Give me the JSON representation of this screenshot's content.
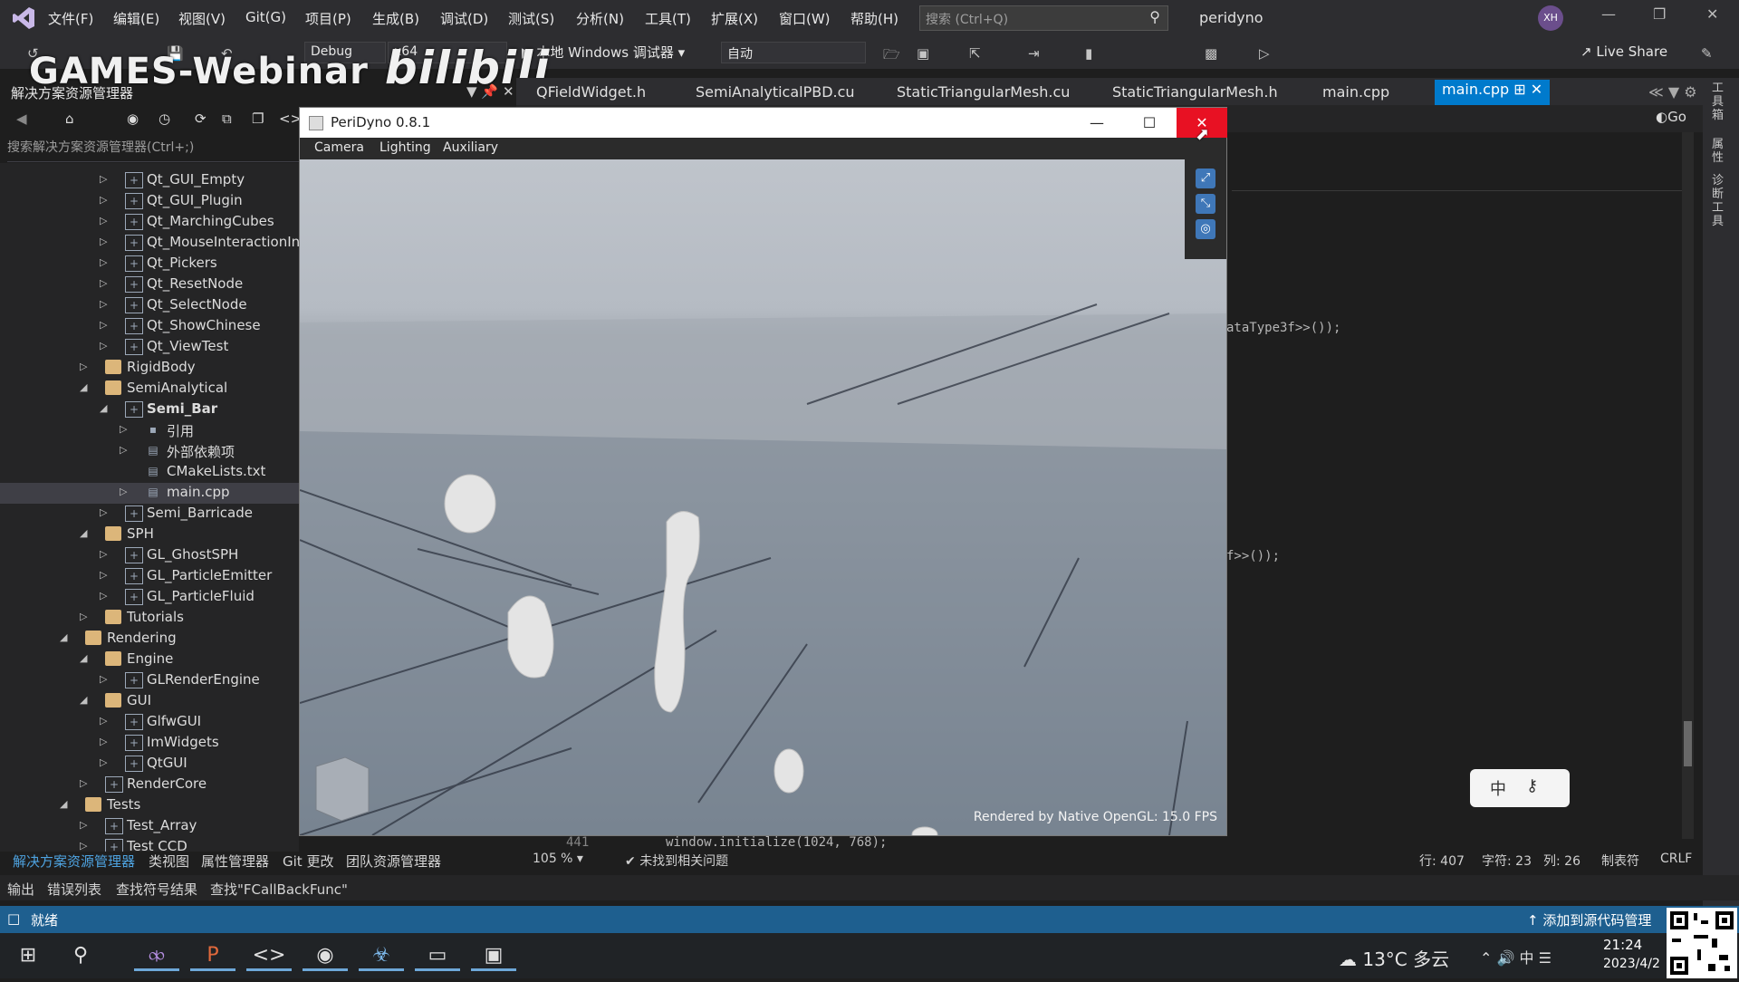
{
  "menubar": {
    "items": [
      "文件(F)",
      "编辑(E)",
      "视图(V)",
      "Git(G)",
      "项目(P)",
      "生成(B)",
      "调试(D)",
      "测试(S)",
      "分析(N)",
      "工具(T)",
      "扩展(X)",
      "窗口(W)",
      "帮助(H)"
    ],
    "search_placeholder": "搜索 (Ctrl+Q)",
    "solution_name": "peridyno",
    "avatar_initials": "XH"
  },
  "toolbar": {
    "watermark_text": "GAMES-Webinar",
    "watermark_brand": "bilibili",
    "config": "Debug",
    "platform": "x64",
    "debugger": "本地 Windows 调试器",
    "auto": "自动",
    "live_share": "Live Share"
  },
  "solution_explorer": {
    "title": "解决方案资源管理器",
    "search_placeholder": "搜索解决方案资源管理器(Ctrl+;)",
    "tree": [
      {
        "label": "Qt_GUI_Empty",
        "level": 3,
        "icon": "project-icon",
        "arrow": "collapsed"
      },
      {
        "label": "Qt_GUI_Plugin",
        "level": 3,
        "icon": "project-icon",
        "arrow": "collapsed"
      },
      {
        "label": "Qt_MarchingCubes",
        "level": 3,
        "icon": "project-icon",
        "arrow": "collapsed"
      },
      {
        "label": "Qt_MouseInteractionInGraph",
        "level": 3,
        "icon": "project-icon",
        "arrow": "collapsed"
      },
      {
        "label": "Qt_Pickers",
        "level": 3,
        "icon": "project-icon",
        "arrow": "collapsed"
      },
      {
        "label": "Qt_ResetNode",
        "level": 3,
        "icon": "project-icon",
        "arrow": "collapsed"
      },
      {
        "label": "Qt_SelectNode",
        "level": 3,
        "icon": "project-icon",
        "arrow": "collapsed"
      },
      {
        "label": "Qt_ShowChinese",
        "level": 3,
        "icon": "project-icon",
        "arrow": "collapsed"
      },
      {
        "label": "Qt_ViewTest",
        "level": 3,
        "icon": "project-icon",
        "arrow": "collapsed"
      },
      {
        "label": "RigidBody",
        "level": 2,
        "icon": "folder-icon",
        "arrow": "collapsed"
      },
      {
        "label": "SemiAnalytical",
        "level": 2,
        "icon": "folder-icon",
        "arrow": "expanded"
      },
      {
        "label": "Semi_Bar",
        "level": 3,
        "icon": "project-icon",
        "arrow": "expanded",
        "bold": true
      },
      {
        "label": "引用",
        "level": 4,
        "icon": "references-icon",
        "arrow": "collapsed"
      },
      {
        "label": "外部依赖项",
        "level": 4,
        "icon": "external-deps-icon",
        "arrow": "collapsed"
      },
      {
        "label": "CMakeLists.txt",
        "level": 4,
        "icon": "file-icon",
        "arrow": "none"
      },
      {
        "label": "main.cpp",
        "level": 4,
        "icon": "cpp-file-icon",
        "arrow": "collapsed",
        "selected": true
      },
      {
        "label": "Semi_Barricade",
        "level": 3,
        "icon": "project-icon",
        "arrow": "collapsed"
      },
      {
        "label": "SPH",
        "level": 2,
        "icon": "folder-icon",
        "arrow": "expanded"
      },
      {
        "label": "GL_GhostSPH",
        "level": 3,
        "icon": "project-icon",
        "arrow": "collapsed"
      },
      {
        "label": "GL_ParticleEmitter",
        "level": 3,
        "icon": "project-icon",
        "arrow": "collapsed"
      },
      {
        "label": "GL_ParticleFluid",
        "level": 3,
        "icon": "project-icon",
        "arrow": "collapsed"
      },
      {
        "label": "Tutorials",
        "level": 2,
        "icon": "folder-icon",
        "arrow": "collapsed"
      },
      {
        "label": "Rendering",
        "level": 1,
        "icon": "folder-icon",
        "arrow": "expanded"
      },
      {
        "label": "Engine",
        "level": 2,
        "icon": "folder-icon",
        "arrow": "expanded"
      },
      {
        "label": "GLRenderEngine",
        "level": 3,
        "icon": "project-icon",
        "arrow": "collapsed"
      },
      {
        "label": "GUI",
        "level": 2,
        "icon": "folder-icon",
        "arrow": "expanded"
      },
      {
        "label": "GlfwGUI",
        "level": 3,
        "icon": "project-icon",
        "arrow": "collapsed"
      },
      {
        "label": "ImWidgets",
        "level": 3,
        "icon": "project-icon",
        "arrow": "collapsed"
      },
      {
        "label": "QtGUI",
        "level": 3,
        "icon": "project-icon",
        "arrow": "collapsed"
      },
      {
        "label": "RenderCore",
        "level": 2,
        "icon": "project-icon",
        "arrow": "collapsed"
      },
      {
        "label": "Tests",
        "level": 1,
        "icon": "folder-icon",
        "arrow": "expanded"
      },
      {
        "label": "Test_Array",
        "level": 2,
        "icon": "project-icon",
        "arrow": "collapsed"
      },
      {
        "label": "Test CCD",
        "level": 2,
        "icon": "project-icon",
        "arrow": "collapsed"
      }
    ]
  },
  "editor": {
    "tabs": [
      "QFieldWidget.h",
      "SemiAnalyticalPBD.cu",
      "StaticTriangularMesh.cu",
      "StaticTriangularMesh.h",
      "main.cpp"
    ],
    "active_tab": "main.cpp",
    "go_label": "Go",
    "code_fragment_1": "ataType3f>>());",
    "code_fragment_2": "f>>());",
    "line_number": "441",
    "code_line": "window.initialize(1024, 768);",
    "zoom": "105 %",
    "issues": "未找到相关问题",
    "row": "行: 407",
    "char": "字符: 23",
    "col": "列: 26",
    "tabs_mode": "制表符",
    "eol": "CRLF"
  },
  "bottom": {
    "tabs1": [
      "解决方案资源管理器",
      "类视图",
      "属性管理器",
      "Git 更改",
      "团队资源管理器"
    ],
    "tabs2": [
      "输出",
      "错误列表",
      "查找符号结果",
      "查找\"FCallBackFunc\""
    ],
    "status": "就绪",
    "add_source": "添加到源代码管理"
  },
  "right_rail": [
    "工具箱",
    "属性",
    "诊断工具"
  ],
  "peridyno": {
    "title": "PeriDyno 0.8.1",
    "menu": [
      "Camera",
      "Lighting",
      "Auxiliary"
    ],
    "fps_text": "Rendered by Native OpenGL: 15.0 FPS"
  },
  "ime": {
    "label": "中"
  },
  "taskbar": {
    "weather": "13°C 多云",
    "ime": "中",
    "time": "21:24",
    "date": "2023/4/2"
  },
  "colors": {
    "accent": "#007acc",
    "close_red": "#e81123",
    "status_bar": "#1e5f8f"
  }
}
